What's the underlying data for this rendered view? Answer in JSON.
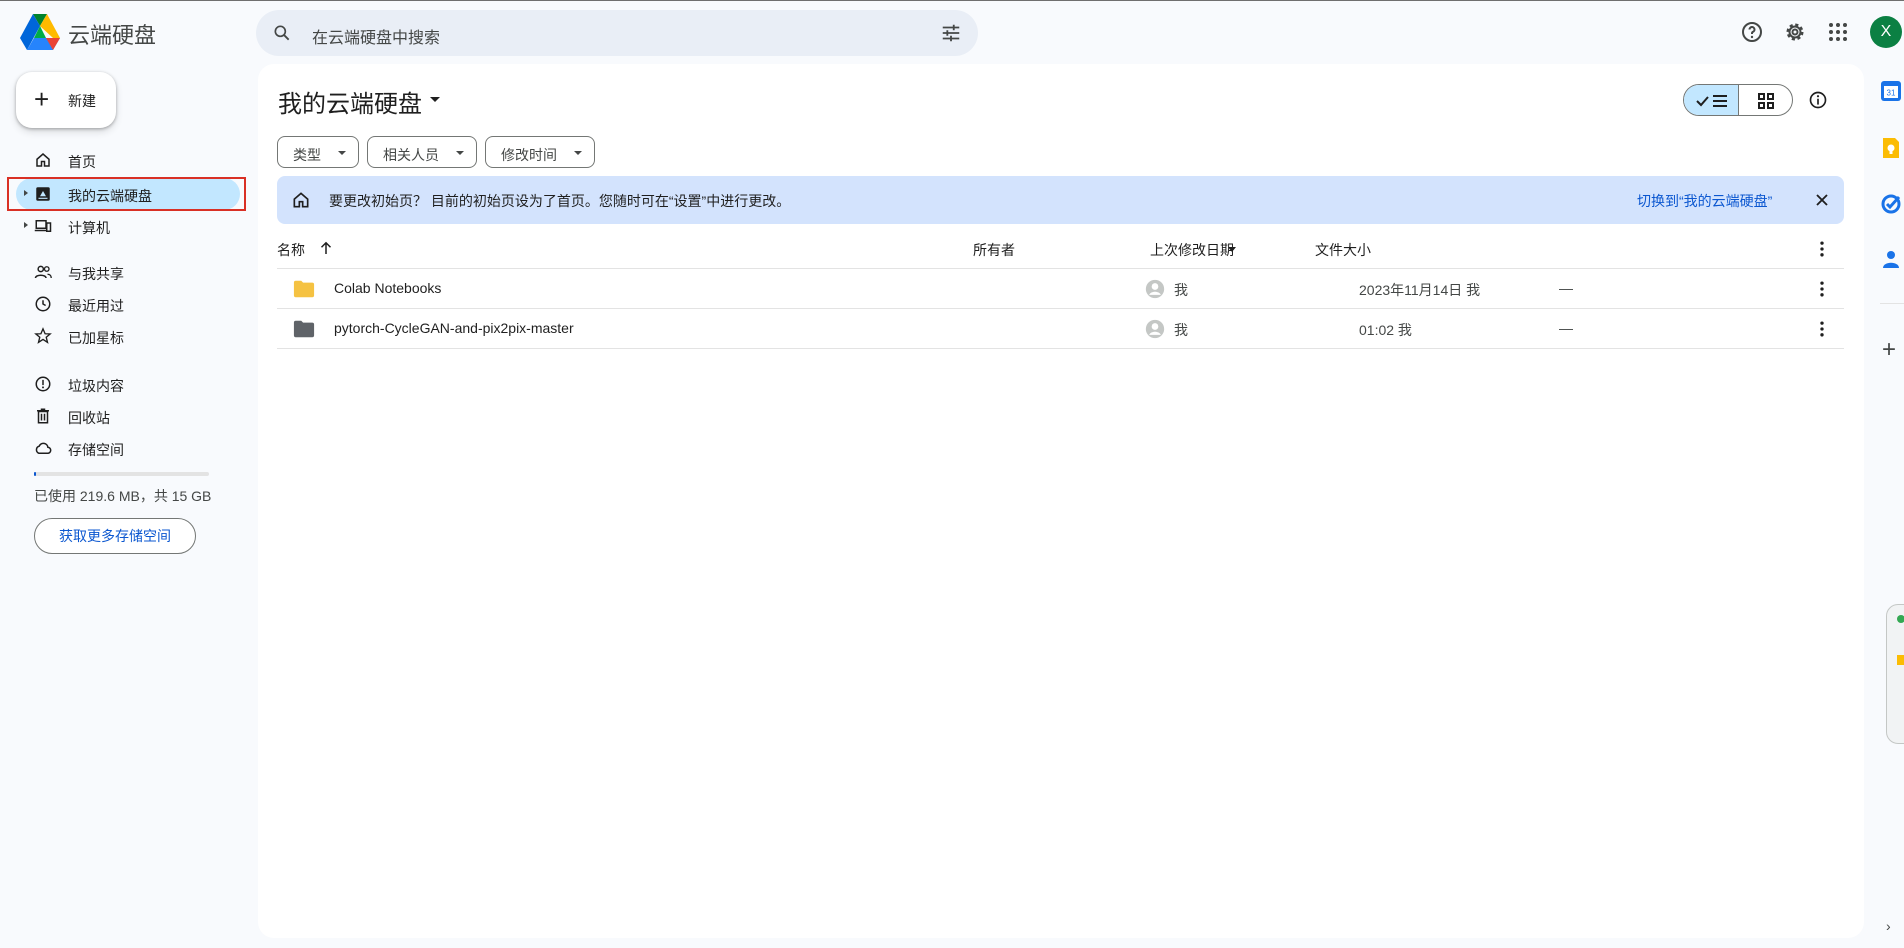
{
  "header": {
    "app_title": "云端硬盘",
    "search_placeholder": "在云端硬盘中搜索",
    "avatar_letter": "X"
  },
  "sidebar": {
    "new_label": "新建",
    "items": [
      {
        "label": "首页",
        "icon": "home-icon"
      },
      {
        "label": "我的云端硬盘",
        "icon": "my-drive-icon",
        "active": true
      },
      {
        "label": "计算机",
        "icon": "computers-icon"
      },
      {
        "label": "与我共享",
        "icon": "shared-people-icon"
      },
      {
        "label": "最近用过",
        "icon": "clock-icon"
      },
      {
        "label": "已加星标",
        "icon": "star-icon"
      },
      {
        "label": "垃圾内容",
        "icon": "spam-icon"
      },
      {
        "label": "回收站",
        "icon": "trash-icon"
      },
      {
        "label": "存储空间",
        "icon": "cloud-icon"
      }
    ],
    "quota_fraction": 0.014,
    "quota_text": "已使用 219.6 MB，共 15 GB",
    "get_storage_label": "获取更多存储空间"
  },
  "main": {
    "title": "我的云端硬盘",
    "filters": [
      "类型",
      "相关人员",
      "修改时间"
    ],
    "banner": {
      "text": "要更改初始页？ 目前的初始页设为了首页。您随时可在“设置”中进行更改。",
      "link": "切换到“我的云端硬盘”"
    },
    "columns": {
      "name": "名称",
      "owner": "所有者",
      "modified": "上次修改日期",
      "size": "文件大小"
    },
    "rows": [
      {
        "name": "Colab Notebooks",
        "owner": "我",
        "modified": "2023年11月14日 我",
        "size": "—",
        "folder_color": "#f5c242"
      },
      {
        "name": "pytorch-CycleGAN-and-pix2pix-master",
        "owner": "我",
        "modified": "01:02 我",
        "size": "—",
        "folder_color": "#5f6368"
      }
    ]
  },
  "colors": {
    "accent": "#0b57d0",
    "selected": "#c2e7ff",
    "banner": "#d3e3fd",
    "highlight_box": "#d93025"
  }
}
